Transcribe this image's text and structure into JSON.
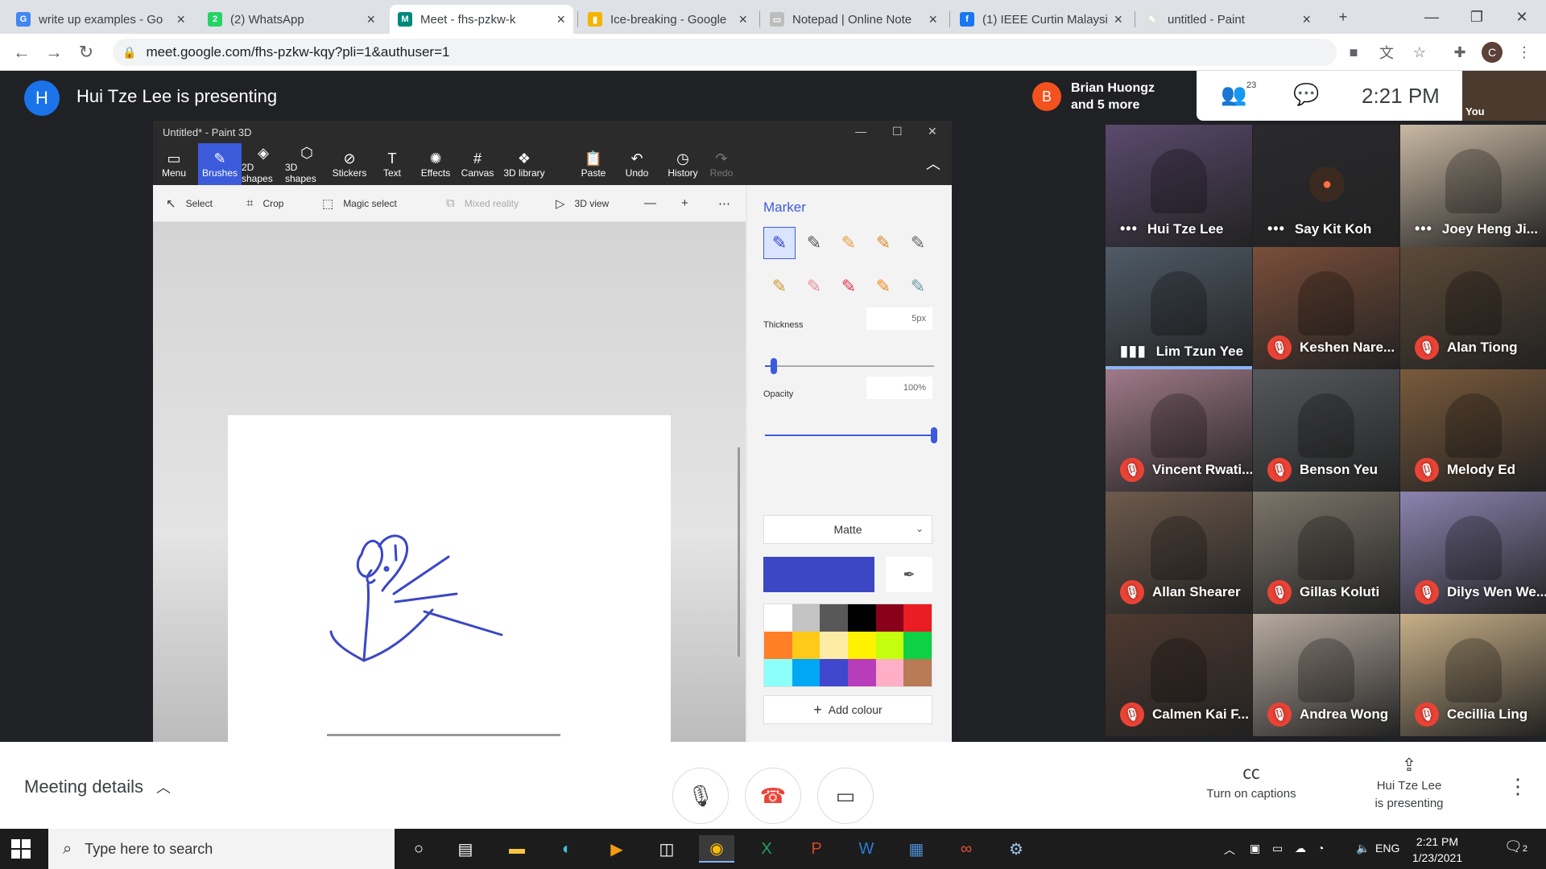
{
  "browser": {
    "tabs": [
      {
        "title": "write up examples - Go",
        "favicon": "google-icon",
        "color": "#4285f4",
        "glyph": "G"
      },
      {
        "title": "(2) WhatsApp",
        "favicon": "whatsapp-icon",
        "color": "#25d366",
        "glyph": "2"
      },
      {
        "title": "Meet - fhs-pzkw-k",
        "favicon": "meet-icon",
        "color": "#00897b",
        "glyph": "M"
      },
      {
        "title": "Ice-breaking - Google",
        "favicon": "google-slides-icon",
        "color": "#f4b400",
        "glyph": "▮"
      },
      {
        "title": "Notepad | Online Note",
        "favicon": "notepad-icon",
        "color": "#bdbdbd",
        "glyph": "▭"
      },
      {
        "title": "(1) IEEE Curtin Malaysia",
        "favicon": "facebook-icon",
        "color": "#1877f2",
        "glyph": "f"
      },
      {
        "title": "untitled - Paint",
        "favicon": "paint-icon",
        "color": "#e0e0e0",
        "glyph": "✎"
      }
    ],
    "url": "meet.google.com/fhs-pzkw-kqy?pli=1&authuser=1",
    "profile_initial": "C"
  },
  "meet": {
    "presenter_initial": "H",
    "presenter_title": "Hui Tze Lee is presenting",
    "joined_initial": "B",
    "joined_line1": "Brian Huongz",
    "joined_line2": "and 5 more",
    "participant_count": "23",
    "time": "2:21 PM",
    "you_label": "You",
    "participants": [
      {
        "name": "Hui Tze Lee",
        "state": "dots",
        "bg": "#5b4a6e"
      },
      {
        "name": "Say Kit Koh",
        "state": "dots",
        "bg": "#2a2a2e"
      },
      {
        "name": "Joey Heng Ji...",
        "state": "dots",
        "bg": "#c9b9a4"
      },
      {
        "name": "Lim Tzun Yee",
        "state": "speaking",
        "bg": "#4f5b67"
      },
      {
        "name": "Keshen Nare...",
        "state": "muted",
        "bg": "#7a4e3a"
      },
      {
        "name": "Alan Tiong",
        "state": "muted",
        "bg": "#5c4a38"
      },
      {
        "name": "Vincent Rwati...",
        "state": "muted",
        "bg": "#a07a88"
      },
      {
        "name": "Benson Yeu",
        "state": "muted",
        "bg": "#55585c"
      },
      {
        "name": "Melody Ed",
        "state": "muted",
        "bg": "#7a5a3c"
      },
      {
        "name": "Allan Shearer",
        "state": "muted",
        "bg": "#6d5a4c"
      },
      {
        "name": "Gillas Koluti",
        "state": "muted",
        "bg": "#7c756a"
      },
      {
        "name": "Dilys Wen We...",
        "state": "muted",
        "bg": "#8c84b0"
      },
      {
        "name": "Calmen Kai F...",
        "state": "muted",
        "bg": "#4e3a30"
      },
      {
        "name": "Andrea Wong",
        "state": "muted",
        "bg": "#b7aba0"
      },
      {
        "name": "Cecillia Ling",
        "state": "muted",
        "bg": "#c8b088"
      }
    ],
    "meeting_details": "Meeting details",
    "captions_label": "Turn on captions",
    "presenting_line1": "Hui Tze Lee",
    "presenting_line2": "is presenting"
  },
  "paint": {
    "window_title": "Untitled* - Paint 3D",
    "ribbon": [
      {
        "label": "Menu",
        "icon": "menu-icon",
        "glyph": "▭"
      },
      {
        "label": "Brushes",
        "icon": "brush-icon",
        "glyph": "✎",
        "active": true
      },
      {
        "label": "2D shapes",
        "icon": "2d-shapes-icon",
        "glyph": "◈"
      },
      {
        "label": "3D shapes",
        "icon": "3d-shapes-icon",
        "glyph": "⬡"
      },
      {
        "label": "Stickers",
        "icon": "stickers-icon",
        "glyph": "⊘"
      },
      {
        "label": "Text",
        "icon": "text-icon",
        "glyph": "T"
      },
      {
        "label": "Effects",
        "icon": "effects-icon",
        "glyph": "✺"
      },
      {
        "label": "Canvas",
        "icon": "canvas-icon",
        "glyph": "#"
      },
      {
        "label": "3D library",
        "icon": "3d-library-icon",
        "glyph": "❖"
      },
      {
        "label": "Paste",
        "icon": "paste-icon",
        "glyph": "📋"
      },
      {
        "label": "Undo",
        "icon": "undo-icon",
        "glyph": "↶"
      },
      {
        "label": "History",
        "icon": "history-icon",
        "glyph": "◷"
      },
      {
        "label": "Redo",
        "icon": "redo-icon",
        "glyph": "↷",
        "disabled": true
      }
    ],
    "subbar": {
      "select": "Select",
      "crop": "Crop",
      "magic_select": "Magic select",
      "mixed_reality": "Mixed reality",
      "view_3d": "3D view"
    },
    "panel": {
      "title": "Marker",
      "thickness_label": "Thickness",
      "thickness_value": "5px",
      "thickness_fraction": 0.05,
      "opacity_label": "Opacity",
      "opacity_value": "100%",
      "opacity_fraction": 1.0,
      "finish": "Matte",
      "current_color": "#3b47c4",
      "add_colour": "Add colour",
      "palette": [
        "#ffffff",
        "#c3c3c3",
        "#585858",
        "#000000",
        "#88001b",
        "#ec1c24",
        "#ff7f27",
        "#ffca18",
        "#fdeca6",
        "#fff200",
        "#c4ff0e",
        "#0ed145",
        "#8cfffb",
        "#00a8f3",
        "#3f48cc",
        "#b83dba",
        "#ffaec8",
        "#b97a56"
      ],
      "brushes": [
        {
          "icon": "marker-icon",
          "color": "#3b47c4"
        },
        {
          "icon": "calligraphy-pen-icon",
          "color": "#555"
        },
        {
          "icon": "oil-brush-icon",
          "color": "#e6a03c"
        },
        {
          "icon": "watercolor-icon",
          "color": "#d9892a"
        },
        {
          "icon": "pixel-pen-icon",
          "color": "#666"
        },
        {
          "icon": "pencil-icon",
          "color": "#d29a3a"
        },
        {
          "icon": "eraser-icon",
          "color": "#e88f9c"
        },
        {
          "icon": "crayon-icon",
          "color": "#e0344e"
        },
        {
          "icon": "spray-can-icon",
          "color": "#f08a24"
        },
        {
          "icon": "fill-icon",
          "color": "#6b9aa8"
        }
      ]
    }
  },
  "taskbar": {
    "search_placeholder": "Type here to search",
    "language": "ENG",
    "time": "2:21 PM",
    "date": "1/23/2021",
    "notifications": "2"
  }
}
